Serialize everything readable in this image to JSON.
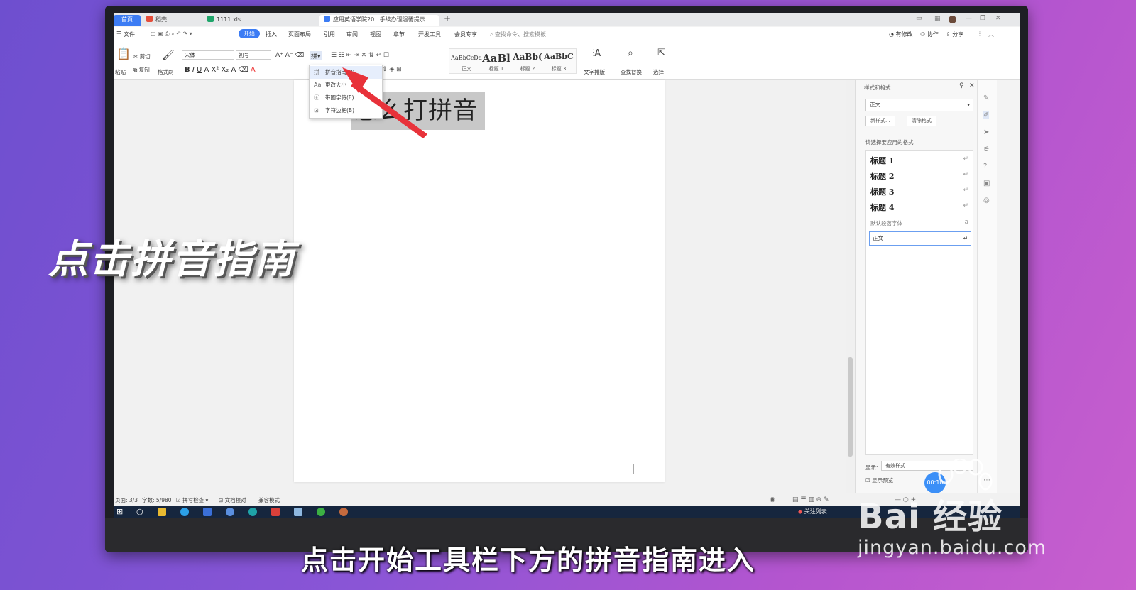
{
  "wps": {
    "tabs": [
      {
        "label": "首页"
      },
      {
        "label": "稻壳"
      },
      {
        "label": "1111.xls"
      },
      {
        "label": "应用英语学院20...手续办理温馨提示"
      }
    ],
    "menu": [
      "文件",
      "开始",
      "插入",
      "页面布局",
      "引用",
      "审阅",
      "视图",
      "章节",
      "开发工具",
      "会员专享"
    ],
    "search_placeholder": "查找命令、搜索模板",
    "top_right": [
      "有修改",
      "协作",
      "分享"
    ],
    "ribbon": {
      "paste": "粘贴",
      "cut": "剪切",
      "copy": "复制",
      "format_painter": "格式刷",
      "font_name": "宋体",
      "font_size": "初号",
      "styles": [
        {
          "preview": "AaBbCcDd",
          "label": "正文"
        },
        {
          "preview": "AaBl",
          "label": "标题 1"
        },
        {
          "preview": "AaBb(",
          "label": "标题 2"
        },
        {
          "preview": "AaBbC",
          "label": "标题 3"
        }
      ],
      "text_layout": "文字排版",
      "find_replace": "查找替换",
      "select": "选择"
    },
    "dropdown": [
      {
        "label": "拼音指南(U)...",
        "icon": "pinyin-icon"
      },
      {
        "label": "更改大小",
        "icon": "aa-icon"
      },
      {
        "label": "带圈字符(E)...",
        "icon": "circle-char-icon"
      },
      {
        "label": "字符边框(B)",
        "icon": "border-char-icon"
      }
    ],
    "doc_text": "怎么打拼音",
    "panel": {
      "title": "样式和格式",
      "current_style": "正文",
      "new_style": "新样式...",
      "clear_format": "清除格式",
      "apply_label": "请选择要应用的格式",
      "styles": [
        "标题  1",
        "标题  2",
        "标题  3",
        "标题  4"
      ],
      "default_font": "默认段落字体",
      "selected": "正文",
      "show_label": "显示:",
      "show_value": "有效样式",
      "preview_label": "显示预览"
    },
    "status": {
      "page": "页面: 3/3",
      "words": "字数: 5/980",
      "spell": "拼写检查",
      "doc_check": "文档校对",
      "compat": "兼容模式"
    },
    "timer": "00:10",
    "taskbar_text": "关注列表"
  },
  "overlay": {
    "caption": "点击拼音指南",
    "subtitle": "点击开始工具栏下方的拼音指南进入"
  },
  "watermark": {
    "logo": "Bai 经验",
    "url": "jingyan.baidu.com"
  },
  "colors": {
    "accent": "#3c7cf4",
    "arrow": "#e8323a",
    "selection": "#c8c8c8"
  }
}
